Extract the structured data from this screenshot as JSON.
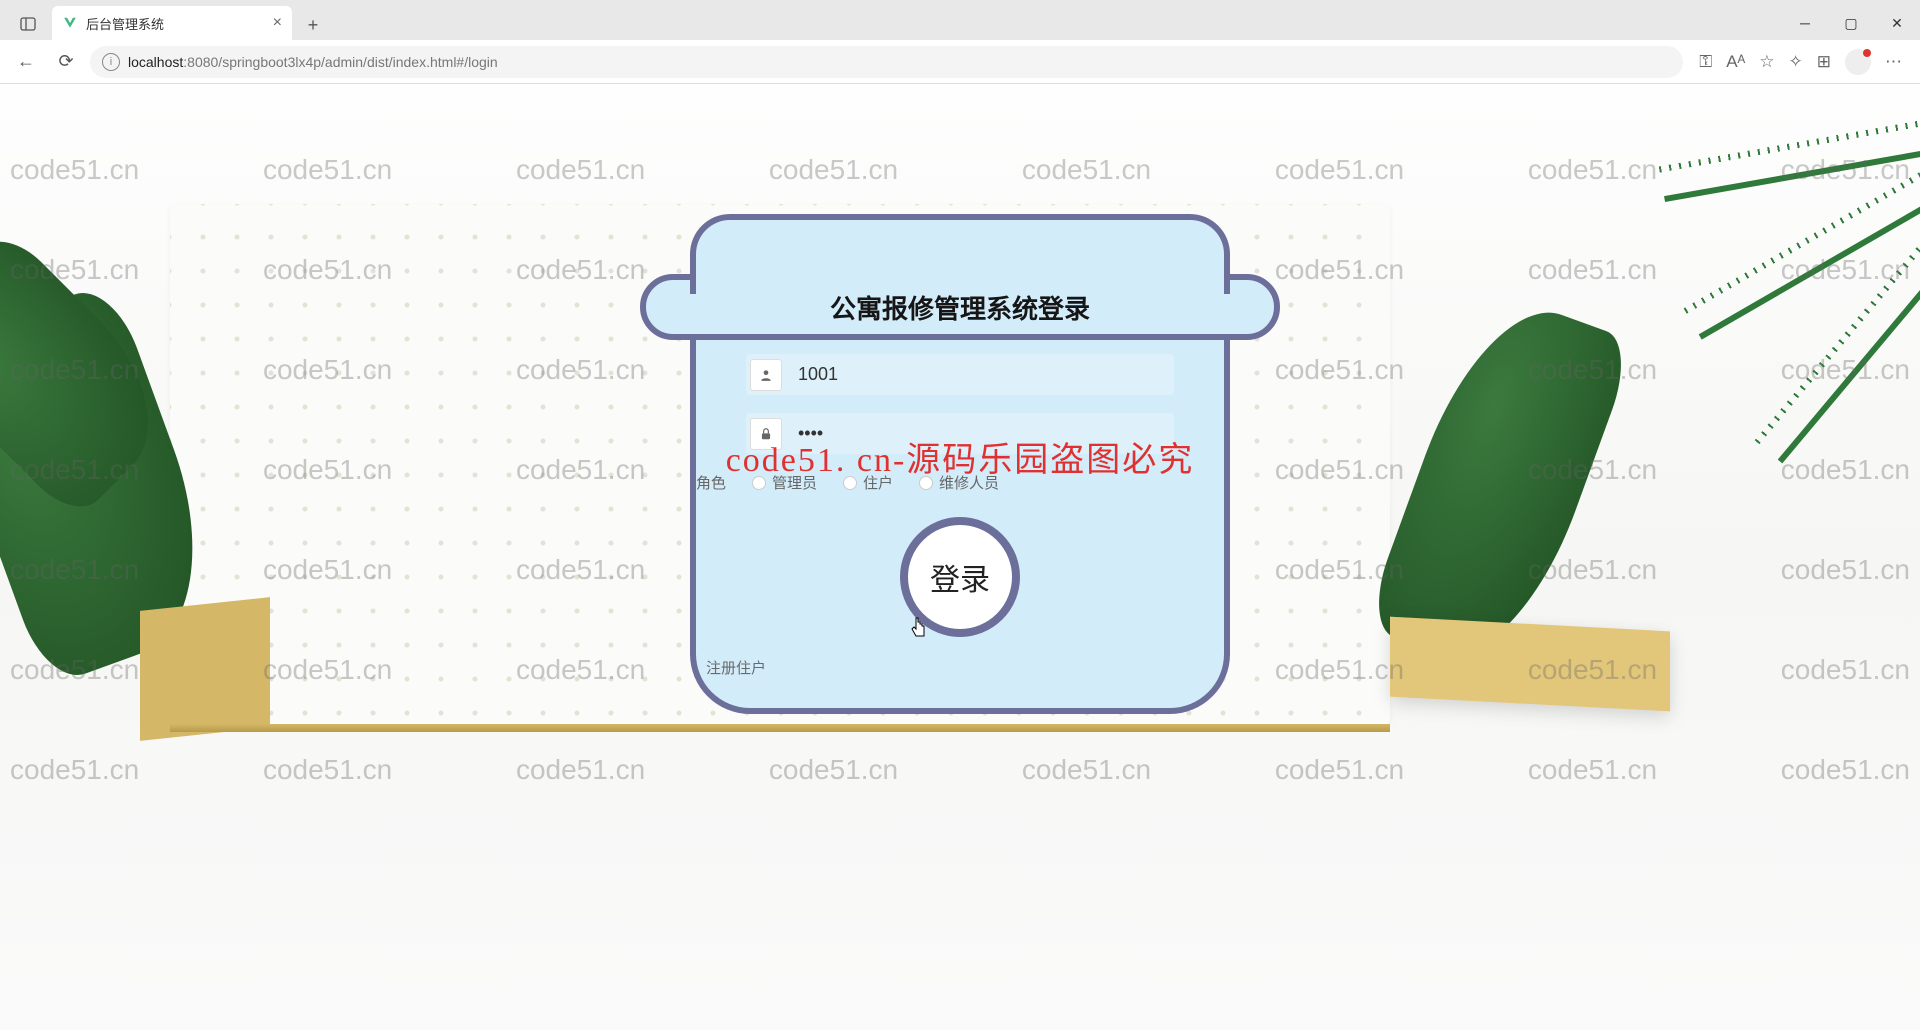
{
  "browser": {
    "tab_title": "后台管理系统",
    "url_host": "localhost",
    "url_port_path": ":8080/springboot3lx4p/admin/dist/index.html#/login"
  },
  "watermark_text": "code51.cn",
  "login": {
    "title": "公寓报修管理系统登录",
    "username_value": "1001",
    "password_value": "••••",
    "role_label": "角色",
    "roles": {
      "admin": "管理员",
      "resident": "住户",
      "repairer": "维修人员"
    },
    "submit_label": "登录",
    "register_link": "注册住户"
  },
  "overlay_warning": "code51. cn-源码乐园盗图必究"
}
